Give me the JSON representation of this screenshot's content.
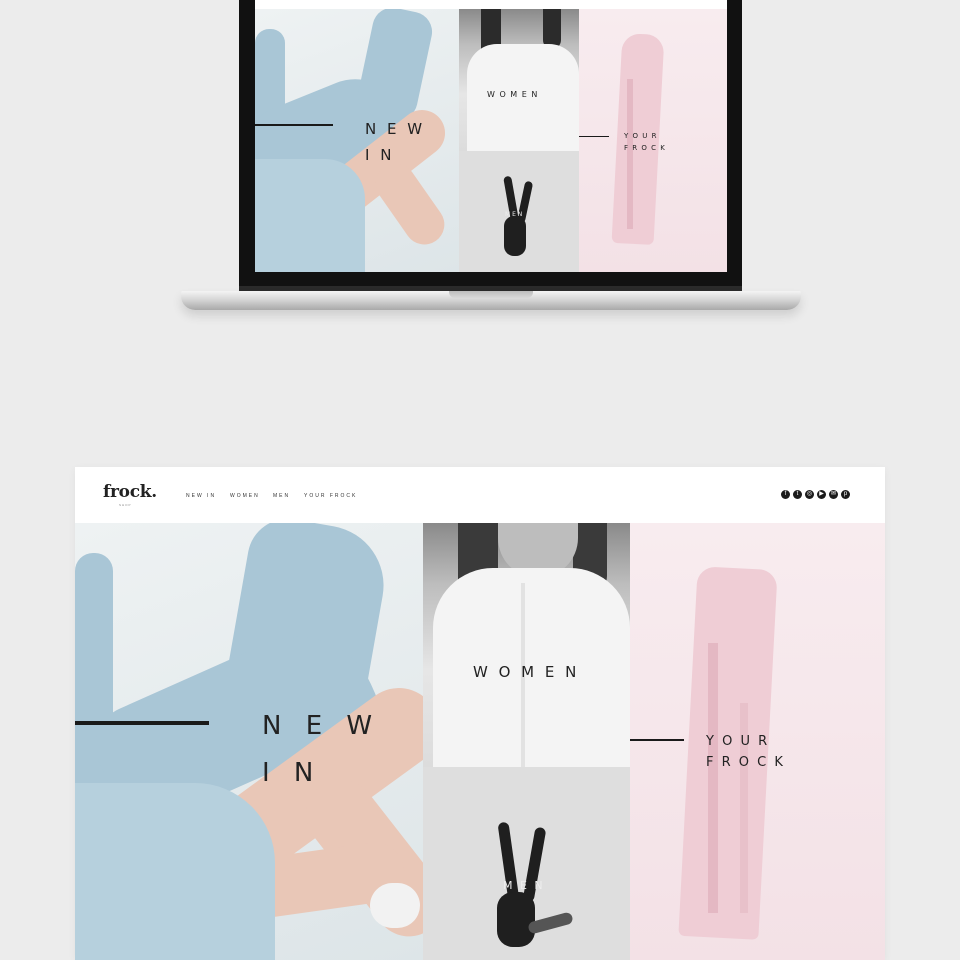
{
  "brand": {
    "logo": "frock.",
    "tagline": "SHOP"
  },
  "nav": {
    "items": [
      {
        "label": "NEW IN"
      },
      {
        "label": "WOMEN"
      },
      {
        "label": "MEN"
      },
      {
        "label": "YOUR FROCK"
      }
    ]
  },
  "social": [
    "facebook-icon",
    "twitter-icon",
    "instagram-icon",
    "youtube-icon",
    "mail-icon",
    "pinterest-icon"
  ],
  "panels": {
    "new_in": "N E W\nI N",
    "women": "W O M E N",
    "men": "M E N",
    "your_frock": "Y O U R\nF R O C K"
  },
  "colors": {
    "page_bg": "#ececec",
    "accent_blue": "#a9c6d6",
    "accent_pink": "#efcdd5",
    "text": "#222222"
  }
}
